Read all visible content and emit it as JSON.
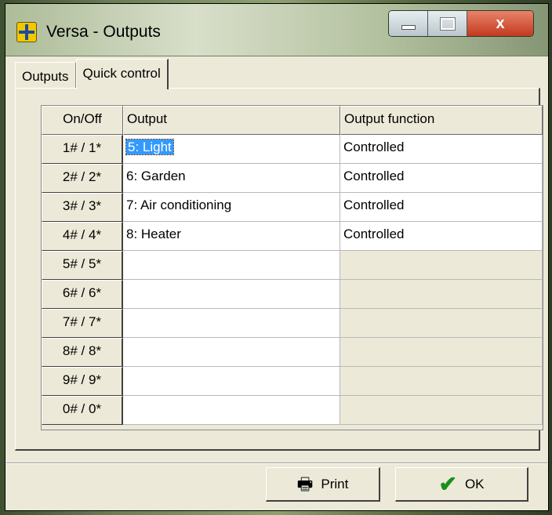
{
  "window": {
    "title": "Versa - Outputs",
    "icon": "app-icon",
    "controls": {
      "close_label": "x"
    }
  },
  "tabs": [
    {
      "label": "Outputs",
      "active": false
    },
    {
      "label": "Quick control",
      "active": true
    }
  ],
  "table": {
    "columns": [
      "On/Off",
      "Output",
      "Output function"
    ],
    "rows": [
      {
        "switch": "1# / 1*",
        "output": "5: Light",
        "function": "Controlled",
        "selected": true
      },
      {
        "switch": "2# / 2*",
        "output": "6: Garden",
        "function": "Controlled"
      },
      {
        "switch": "3# / 3*",
        "output": "7: Air conditioning",
        "function": "Controlled"
      },
      {
        "switch": "4# / 4*",
        "output": "8: Heater",
        "function": "Controlled"
      },
      {
        "switch": "5# / 5*",
        "output": "",
        "function": ""
      },
      {
        "switch": "6# / 6*",
        "output": "",
        "function": ""
      },
      {
        "switch": "7# / 7*",
        "output": "",
        "function": ""
      },
      {
        "switch": "8# / 8*",
        "output": "",
        "function": ""
      },
      {
        "switch": "9# / 9*",
        "output": "",
        "function": ""
      },
      {
        "switch": "0# / 0*",
        "output": "",
        "function": ""
      }
    ]
  },
  "buttons": {
    "print_label": "Print",
    "print_icon": "printer-icon",
    "ok_label": "OK",
    "ok_icon": "checkmark-icon"
  },
  "colors": {
    "selection": "#3399ff",
    "window_bg": "#ece9d8",
    "close_button": "#c23a1f",
    "ok_check": "#1a8f1a"
  }
}
